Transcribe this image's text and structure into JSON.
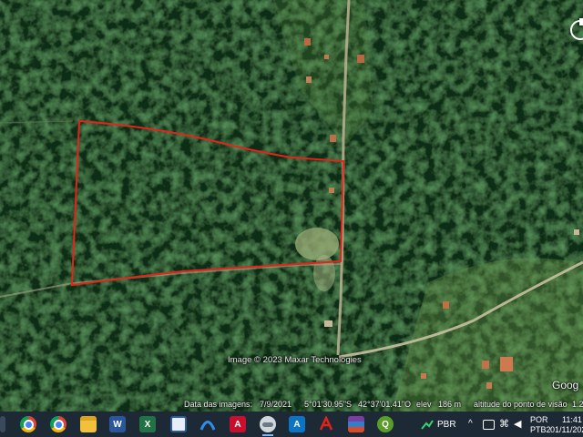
{
  "map": {
    "imagery_credit": "Image © 2023 Maxar Technologies",
    "imagery_date_label": "Data das imagens:",
    "imagery_date": "7/9/2021",
    "latitude": "5°01'30.95\"S",
    "longitude": "42°37'01.41\"O",
    "elevation_label": "elev",
    "elevation": "186 m",
    "eye_altitude_label": "altitude do ponto de visão",
    "eye_altitude": "1.2",
    "provider_logo": "Goog",
    "boundary_color": "#e3241b"
  },
  "taskbar": {
    "apps": [
      {
        "name": "chrome-icon"
      },
      {
        "name": "chrome-profile-icon"
      },
      {
        "name": "file-explorer-icon"
      },
      {
        "name": "word-icon",
        "glyph": "W"
      },
      {
        "name": "excel-icon",
        "glyph": "X"
      },
      {
        "name": "photos-icon"
      },
      {
        "name": "remote-access-icon"
      },
      {
        "name": "autocad-icon",
        "glyph": "A"
      },
      {
        "name": "google-earth-icon"
      },
      {
        "name": "autocad-alt-icon",
        "glyph": "A"
      },
      {
        "name": "acrobat-icon"
      },
      {
        "name": "winrar-icon"
      },
      {
        "name": "qgis-icon",
        "glyph": "Q"
      }
    ],
    "stock_ticker": "PBR",
    "language": "POR",
    "keyboard_layout": "PTB2",
    "time": "11:41",
    "date": "01/11/202"
  }
}
